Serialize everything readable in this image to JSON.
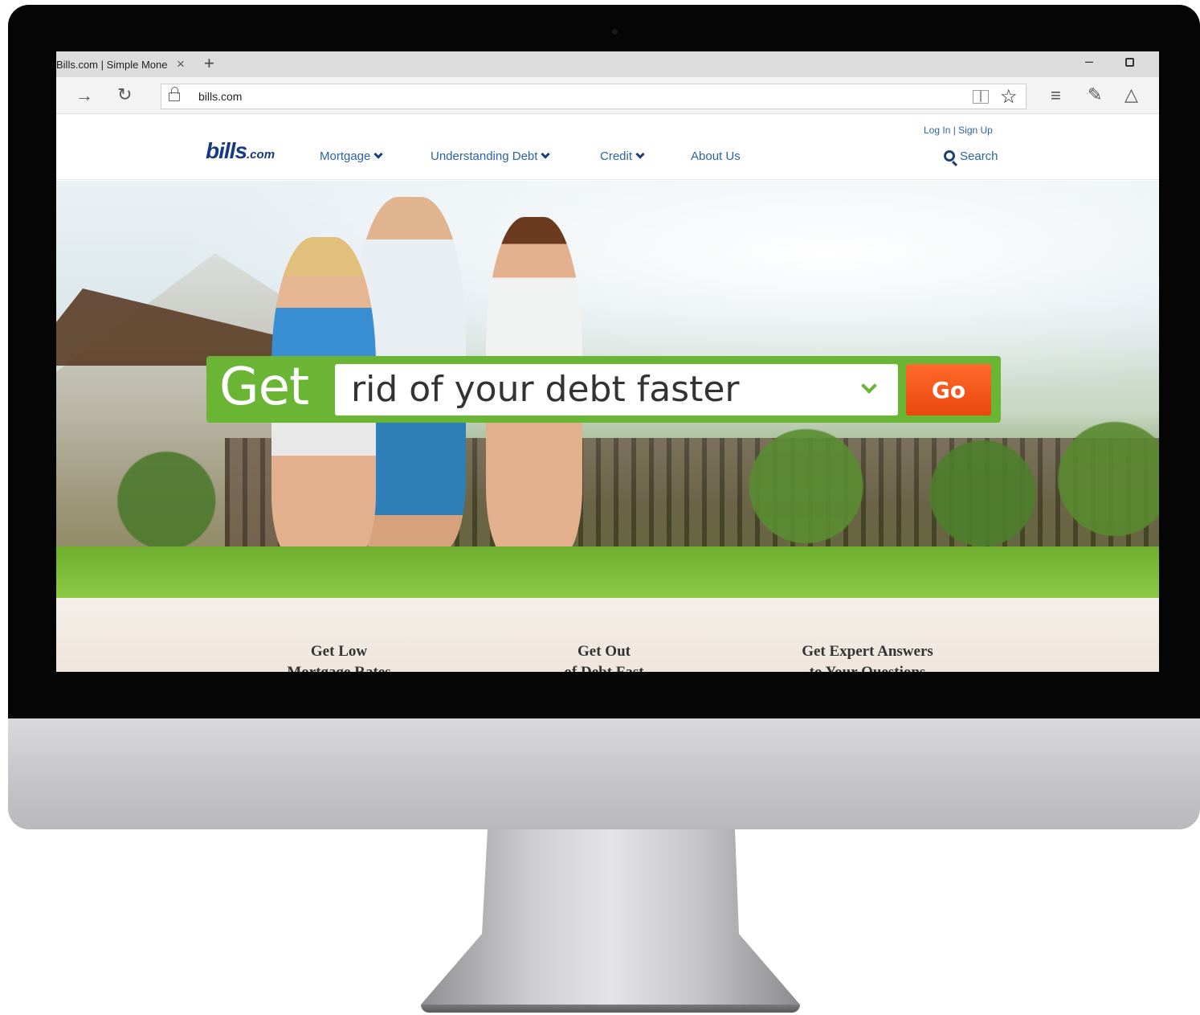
{
  "browser": {
    "tab_title": "Bills.com | Simple Mone",
    "tab_close": "×",
    "new_tab": "+",
    "url": "bills.com"
  },
  "site": {
    "logo_main": "bills",
    "logo_suffix": ".com",
    "nav": [
      {
        "label": "Mortgage",
        "dropdown": true
      },
      {
        "label": "Understanding Debt",
        "dropdown": true
      },
      {
        "label": "Credit",
        "dropdown": true
      },
      {
        "label": "About Us",
        "dropdown": false
      }
    ],
    "login": "Log In | Sign Up",
    "search_label": "Search"
  },
  "hero": {
    "get_word": "Get",
    "selected_option": "rid of your debt faster",
    "go_label": "Go"
  },
  "teaser": [
    {
      "line1": "Get Low",
      "line2": "Mortgage Rates"
    },
    {
      "line1": "Get Out",
      "line2": "of Debt Fast"
    },
    {
      "line1": "Get Expert Answers",
      "line2": "to Your Questions"
    }
  ],
  "colors": {
    "brand_blue": "#183a82",
    "link_blue": "#2b63a8",
    "green": "#6ab534",
    "go_orange": "#f05a1e"
  }
}
